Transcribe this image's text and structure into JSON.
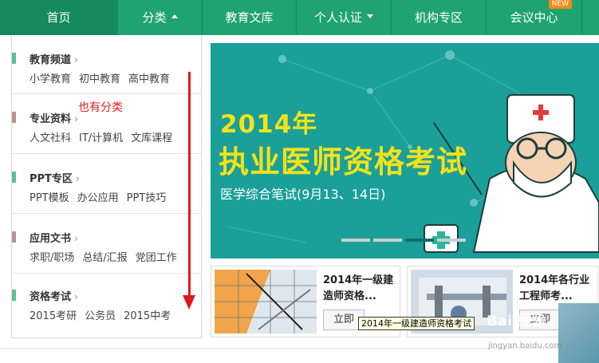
{
  "nav": {
    "items": [
      {
        "label": "首页",
        "active": true
      },
      {
        "label": "分类",
        "caret": "up"
      },
      {
        "label": "教育文库"
      },
      {
        "label": "个人认证",
        "caret": "down"
      },
      {
        "label": "机构专区"
      },
      {
        "label": "会议中心",
        "badge": "NEW"
      }
    ]
  },
  "categories": [
    {
      "title": "教育频道",
      "color": "#5cc08e",
      "links": [
        "小学教育",
        "初中教育",
        "高中教育"
      ]
    },
    {
      "title": "专业资料",
      "color": "#b9958c",
      "links": [
        "人文社科",
        "IT/计算机",
        "文库课程"
      ]
    },
    {
      "title": "PPT专区",
      "color": "#5cc08e",
      "links": [
        "PPT模板",
        "办公应用",
        "PPT技巧"
      ]
    },
    {
      "title": "应用文书",
      "color": "#b9958c",
      "links": [
        "求职/职场",
        "总结/汇报",
        "党团工作"
      ]
    },
    {
      "title": "资格考试",
      "color": "#5cc08e",
      "links": [
        "2015考研",
        "公务员",
        "2015中考"
      ]
    }
  ],
  "annotation": "也有分类",
  "banner": {
    "year": "2014年",
    "title": "执业医师资格考试",
    "subtitle": "医学综合笔试(9月13、14日)",
    "slides": 4,
    "active_slide": 3
  },
  "cards": [
    {
      "title_line1": "2014年一级建",
      "title_line2": "造师资格...",
      "button": "立即"
    },
    {
      "title_line1": "2014年各行业",
      "title_line2": "工程师考...",
      "button": "立即"
    }
  ],
  "tooltip": "2014年一级建造师资格考试",
  "watermark": "Bai 经验",
  "watermark_url": "jingyan.baidu.com",
  "colors": {
    "nav_bg": "#1fa36f",
    "banner_bg": "#1a9f99",
    "title_yellow": "#f3e21a",
    "annotation_red": "#e02020"
  }
}
